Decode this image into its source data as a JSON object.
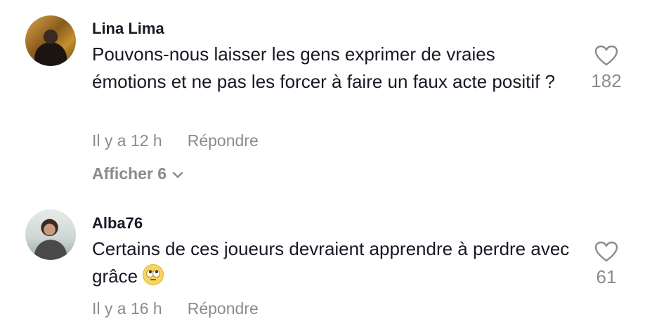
{
  "comments": [
    {
      "username": "Lina Lima",
      "text": "Pouvons-nous laisser les gens exprimer de vraies émotions et ne pas les forcer à faire un faux acte positif ?",
      "time": "Il y a 12 h",
      "reply_label": "Répondre",
      "likes": "182",
      "more_replies_label": "Afficher 6"
    },
    {
      "username": "Alba76",
      "text": "Certains de ces joueurs devraient apprendre à perdre avec grâce",
      "emoji": "face-with-rolling-eyes",
      "time": "Il y a 16 h",
      "reply_label": "Répondre",
      "likes": "61"
    }
  ],
  "icons": {
    "like": "heart-outline-icon",
    "expand": "chevron-down-icon"
  },
  "colors": {
    "text": "#161823",
    "muted": "#8a8b91",
    "background": "#ffffff"
  }
}
